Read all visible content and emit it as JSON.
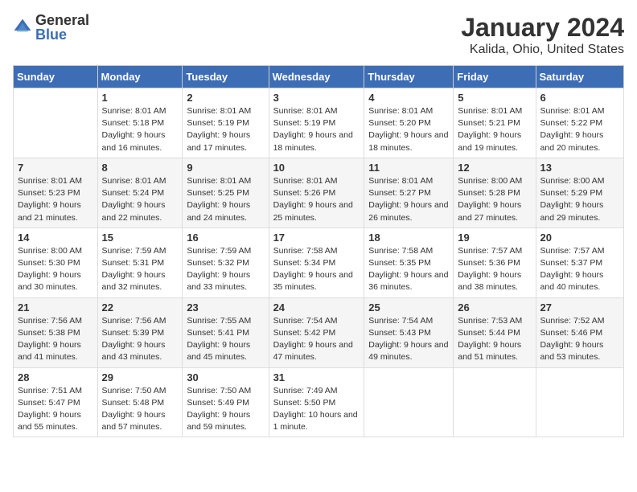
{
  "header": {
    "logo_line1": "General",
    "logo_line2": "Blue",
    "title": "January 2024",
    "subtitle": "Kalida, Ohio, United States"
  },
  "calendar": {
    "days_of_week": [
      "Sunday",
      "Monday",
      "Tuesday",
      "Wednesday",
      "Thursday",
      "Friday",
      "Saturday"
    ],
    "weeks": [
      [
        {
          "day": "",
          "sunrise": "",
          "sunset": "",
          "daylight": ""
        },
        {
          "day": "1",
          "sunrise": "Sunrise: 8:01 AM",
          "sunset": "Sunset: 5:18 PM",
          "daylight": "Daylight: 9 hours and 16 minutes."
        },
        {
          "day": "2",
          "sunrise": "Sunrise: 8:01 AM",
          "sunset": "Sunset: 5:19 PM",
          "daylight": "Daylight: 9 hours and 17 minutes."
        },
        {
          "day": "3",
          "sunrise": "Sunrise: 8:01 AM",
          "sunset": "Sunset: 5:19 PM",
          "daylight": "Daylight: 9 hours and 18 minutes."
        },
        {
          "day": "4",
          "sunrise": "Sunrise: 8:01 AM",
          "sunset": "Sunset: 5:20 PM",
          "daylight": "Daylight: 9 hours and 18 minutes."
        },
        {
          "day": "5",
          "sunrise": "Sunrise: 8:01 AM",
          "sunset": "Sunset: 5:21 PM",
          "daylight": "Daylight: 9 hours and 19 minutes."
        },
        {
          "day": "6",
          "sunrise": "Sunrise: 8:01 AM",
          "sunset": "Sunset: 5:22 PM",
          "daylight": "Daylight: 9 hours and 20 minutes."
        }
      ],
      [
        {
          "day": "7",
          "sunrise": "Sunrise: 8:01 AM",
          "sunset": "Sunset: 5:23 PM",
          "daylight": "Daylight: 9 hours and 21 minutes."
        },
        {
          "day": "8",
          "sunrise": "Sunrise: 8:01 AM",
          "sunset": "Sunset: 5:24 PM",
          "daylight": "Daylight: 9 hours and 22 minutes."
        },
        {
          "day": "9",
          "sunrise": "Sunrise: 8:01 AM",
          "sunset": "Sunset: 5:25 PM",
          "daylight": "Daylight: 9 hours and 24 minutes."
        },
        {
          "day": "10",
          "sunrise": "Sunrise: 8:01 AM",
          "sunset": "Sunset: 5:26 PM",
          "daylight": "Daylight: 9 hours and 25 minutes."
        },
        {
          "day": "11",
          "sunrise": "Sunrise: 8:01 AM",
          "sunset": "Sunset: 5:27 PM",
          "daylight": "Daylight: 9 hours and 26 minutes."
        },
        {
          "day": "12",
          "sunrise": "Sunrise: 8:00 AM",
          "sunset": "Sunset: 5:28 PM",
          "daylight": "Daylight: 9 hours and 27 minutes."
        },
        {
          "day": "13",
          "sunrise": "Sunrise: 8:00 AM",
          "sunset": "Sunset: 5:29 PM",
          "daylight": "Daylight: 9 hours and 29 minutes."
        }
      ],
      [
        {
          "day": "14",
          "sunrise": "Sunrise: 8:00 AM",
          "sunset": "Sunset: 5:30 PM",
          "daylight": "Daylight: 9 hours and 30 minutes."
        },
        {
          "day": "15",
          "sunrise": "Sunrise: 7:59 AM",
          "sunset": "Sunset: 5:31 PM",
          "daylight": "Daylight: 9 hours and 32 minutes."
        },
        {
          "day": "16",
          "sunrise": "Sunrise: 7:59 AM",
          "sunset": "Sunset: 5:32 PM",
          "daylight": "Daylight: 9 hours and 33 minutes."
        },
        {
          "day": "17",
          "sunrise": "Sunrise: 7:58 AM",
          "sunset": "Sunset: 5:34 PM",
          "daylight": "Daylight: 9 hours and 35 minutes."
        },
        {
          "day": "18",
          "sunrise": "Sunrise: 7:58 AM",
          "sunset": "Sunset: 5:35 PM",
          "daylight": "Daylight: 9 hours and 36 minutes."
        },
        {
          "day": "19",
          "sunrise": "Sunrise: 7:57 AM",
          "sunset": "Sunset: 5:36 PM",
          "daylight": "Daylight: 9 hours and 38 minutes."
        },
        {
          "day": "20",
          "sunrise": "Sunrise: 7:57 AM",
          "sunset": "Sunset: 5:37 PM",
          "daylight": "Daylight: 9 hours and 40 minutes."
        }
      ],
      [
        {
          "day": "21",
          "sunrise": "Sunrise: 7:56 AM",
          "sunset": "Sunset: 5:38 PM",
          "daylight": "Daylight: 9 hours and 41 minutes."
        },
        {
          "day": "22",
          "sunrise": "Sunrise: 7:56 AM",
          "sunset": "Sunset: 5:39 PM",
          "daylight": "Daylight: 9 hours and 43 minutes."
        },
        {
          "day": "23",
          "sunrise": "Sunrise: 7:55 AM",
          "sunset": "Sunset: 5:41 PM",
          "daylight": "Daylight: 9 hours and 45 minutes."
        },
        {
          "day": "24",
          "sunrise": "Sunrise: 7:54 AM",
          "sunset": "Sunset: 5:42 PM",
          "daylight": "Daylight: 9 hours and 47 minutes."
        },
        {
          "day": "25",
          "sunrise": "Sunrise: 7:54 AM",
          "sunset": "Sunset: 5:43 PM",
          "daylight": "Daylight: 9 hours and 49 minutes."
        },
        {
          "day": "26",
          "sunrise": "Sunrise: 7:53 AM",
          "sunset": "Sunset: 5:44 PM",
          "daylight": "Daylight: 9 hours and 51 minutes."
        },
        {
          "day": "27",
          "sunrise": "Sunrise: 7:52 AM",
          "sunset": "Sunset: 5:46 PM",
          "daylight": "Daylight: 9 hours and 53 minutes."
        }
      ],
      [
        {
          "day": "28",
          "sunrise": "Sunrise: 7:51 AM",
          "sunset": "Sunset: 5:47 PM",
          "daylight": "Daylight: 9 hours and 55 minutes."
        },
        {
          "day": "29",
          "sunrise": "Sunrise: 7:50 AM",
          "sunset": "Sunset: 5:48 PM",
          "daylight": "Daylight: 9 hours and 57 minutes."
        },
        {
          "day": "30",
          "sunrise": "Sunrise: 7:50 AM",
          "sunset": "Sunset: 5:49 PM",
          "daylight": "Daylight: 9 hours and 59 minutes."
        },
        {
          "day": "31",
          "sunrise": "Sunrise: 7:49 AM",
          "sunset": "Sunset: 5:50 PM",
          "daylight": "Daylight: 10 hours and 1 minute."
        },
        {
          "day": "",
          "sunrise": "",
          "sunset": "",
          "daylight": ""
        },
        {
          "day": "",
          "sunrise": "",
          "sunset": "",
          "daylight": ""
        },
        {
          "day": "",
          "sunrise": "",
          "sunset": "",
          "daylight": ""
        }
      ]
    ]
  }
}
